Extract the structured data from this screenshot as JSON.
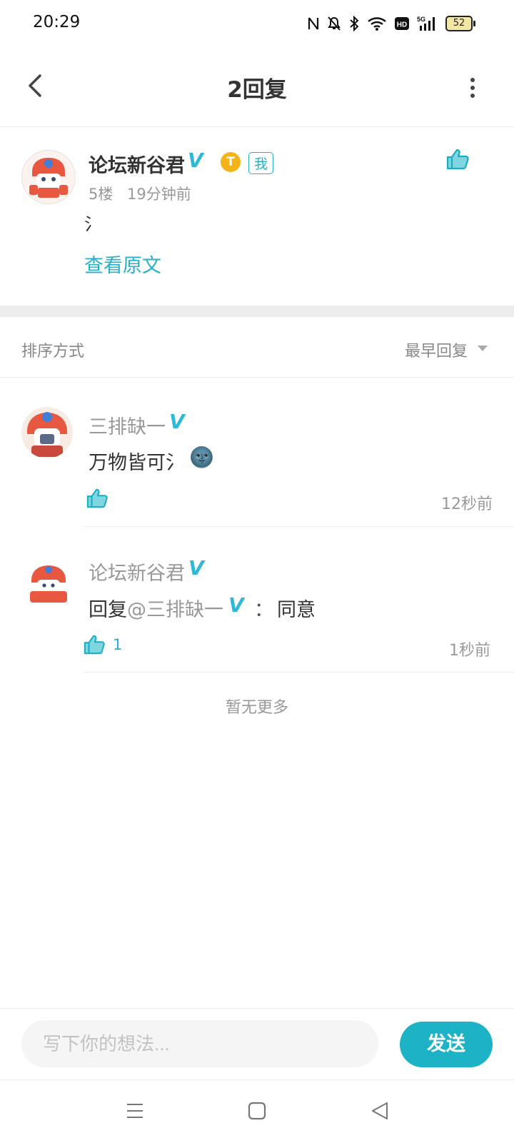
{
  "status_bar": {
    "time": "20:29",
    "battery": "52",
    "network": "5G"
  },
  "header": {
    "title": "2回复"
  },
  "post": {
    "author": "论坛新谷君",
    "badge": "我",
    "coin_letter": "T",
    "floor": "5楼",
    "time": "19分钟前",
    "content": "氵",
    "view_original": "查看原文"
  },
  "sort": {
    "label": "排序方式",
    "value": "最早回复"
  },
  "replies": [
    {
      "author": "三排缺一",
      "text": "万物皆可氵",
      "emoji": "🌚",
      "likes": "",
      "time": "12秒前"
    },
    {
      "author": "论坛新谷君",
      "reply_prefix": "回复",
      "mention": "@三排缺一",
      "separator": "：",
      "text": "同意",
      "likes": "1",
      "time": "1秒前"
    }
  ],
  "no_more": "暂无更多",
  "composer": {
    "placeholder": "写下你的想法...",
    "send_label": "发送"
  },
  "colors": {
    "accent": "#1db3c7",
    "verified": "#2fb9d9",
    "text_muted": "#999999"
  }
}
